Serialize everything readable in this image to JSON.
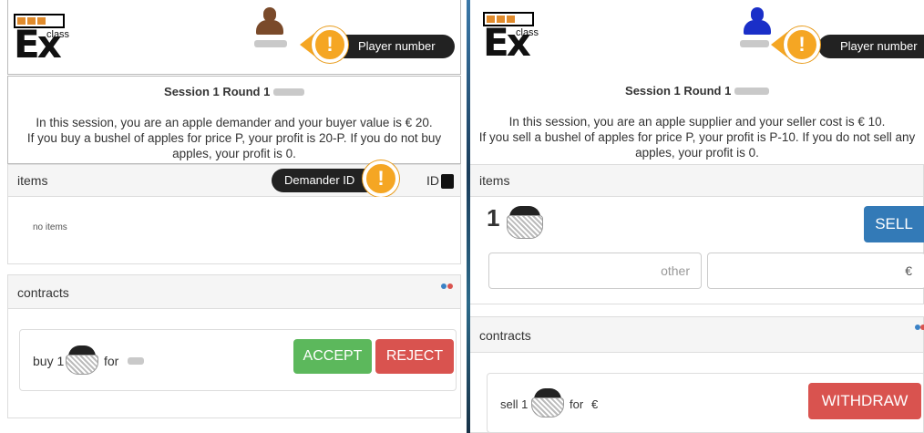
{
  "left": {
    "logo": "class Ex",
    "logo_class": "class",
    "logo_ex": "Ex",
    "player_number_tip": "Player number",
    "session_title": "Session 1 Round 1",
    "session_line1": "In this session, you are an apple demander and your buyer value is € 20.",
    "session_line2": "If you buy a bushel of apples for price P, your profit is 20-P. If you do not buy apples, your profit is 0.",
    "items_header": "items",
    "demander_id_tip": "Demander ID",
    "id_label": "ID",
    "no_items": "no items",
    "contracts_header": "contracts",
    "contract_buy": "buy 1",
    "contract_for": "for",
    "accept_label": "ACCEPT",
    "reject_label": "REJECT",
    "avatar_color": "#7a4a2a"
  },
  "right": {
    "logo": "class Ex",
    "logo_class": "class",
    "logo_ex": "Ex",
    "player_number_tip": "Player number",
    "session_title": "Session 1 Round 1",
    "session_line1": "In this session, you are an apple supplier and your seller cost is € 10.",
    "session_line2": "If you sell a bushel of apples for price P, your profit is P-10. If you do not sell any apples, your profit is 0.",
    "items_header": "items",
    "item_count": "1",
    "sell_label": "SELL",
    "other_placeholder": "other",
    "euro_symbol": "€",
    "contracts_header": "contracts",
    "contract_sell": "sell 1",
    "contract_for": "for",
    "contract_currency": "€",
    "withdraw_label": "WITHDRAW",
    "avatar_color": "#1a2fc8"
  },
  "colors": {
    "warn": "#f5a623",
    "accept": "#5cb85c",
    "reject": "#d9534f",
    "sell": "#337ab7"
  }
}
